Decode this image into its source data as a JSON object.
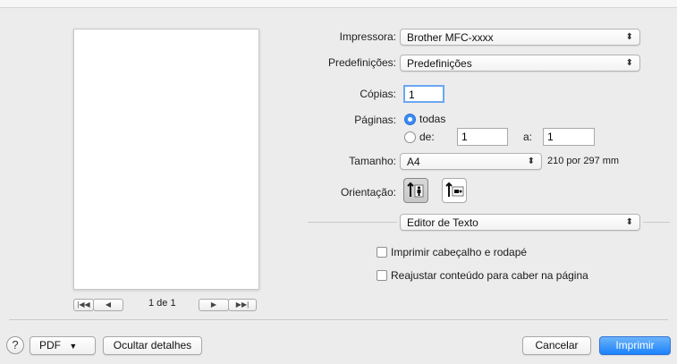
{
  "preview": {
    "page_indicator": "1 de 1"
  },
  "printer": {
    "label": "Impressora:",
    "value": "Brother MFC-xxxx"
  },
  "presets": {
    "label": "Predefinições:",
    "value": "Predefinições"
  },
  "copies": {
    "label": "Cópias:",
    "value": "1"
  },
  "pages": {
    "label": "Páginas:",
    "all_label": "todas",
    "from_label": "de:",
    "from_value": "1",
    "to_label": "a:",
    "to_value": "1",
    "selected": "todas"
  },
  "size": {
    "label": "Tamanho:",
    "value": "A4",
    "dimensions": "210 por 297 mm"
  },
  "orientation": {
    "label": "Orientação:",
    "selected": "portrait"
  },
  "section": {
    "value": "Editor de Texto"
  },
  "options": {
    "header_footer": "Imprimir cabeçalho e rodapé",
    "fit_content": "Reajustar conteúdo para caber na página"
  },
  "footer": {
    "help": "?",
    "pdf": "PDF",
    "hide_details": "Ocultar detalhes",
    "cancel": "Cancelar",
    "print": "Imprimir"
  },
  "icons": {
    "popup_arrows": "↕",
    "first_page": "|◀◀",
    "prev_page": "◀",
    "next_page": "▶",
    "last_page": "▶▶|",
    "pdf_menu": "▾"
  }
}
